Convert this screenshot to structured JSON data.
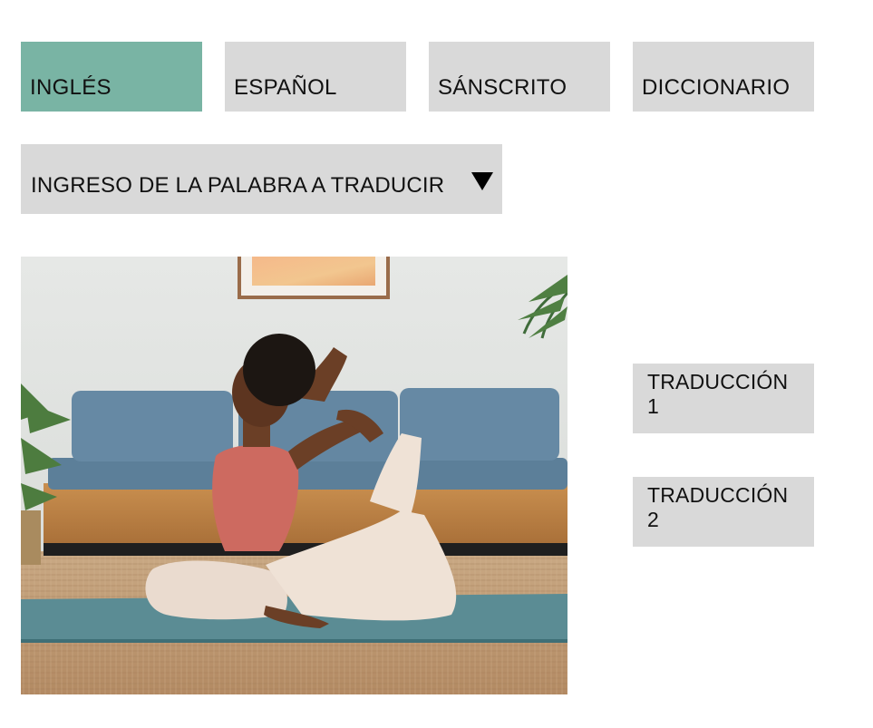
{
  "accent_color": "#79b4a4",
  "tabs": [
    {
      "label": "INGLÉS",
      "active": true
    },
    {
      "label": "ESPAÑOL",
      "active": false
    },
    {
      "label": "SÁNSCRITO",
      "active": false
    },
    {
      "label": "DICCIONARIO",
      "active": false
    }
  ],
  "input": {
    "label": "INGRESO DE LA PALABRA A TRADUCIR",
    "icon": "caret-down-icon"
  },
  "results": [
    {
      "label": "TRADUCCIÓN 1"
    },
    {
      "label": "TRADUCCIÓN 2"
    }
  ]
}
